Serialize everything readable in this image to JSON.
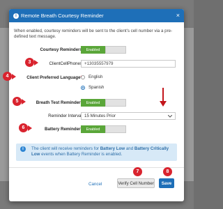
{
  "dialog": {
    "title": "Remote Breath Courtesy Reminder",
    "close_label": "×",
    "intro": "When enabled, courtesy reminders will be sent to the client's cell number via a pre-defined text message."
  },
  "fields": {
    "courtesy_reminders": {
      "label": "Courtesy Reminders",
      "toggle": "Enabled"
    },
    "client_cell_phones": {
      "label": "ClientCellPhones",
      "value": "+13035557979"
    },
    "preferred_language": {
      "label": "Client Preferred Language",
      "options": [
        {
          "label": "English",
          "selected": false
        },
        {
          "label": "Spanish",
          "selected": true
        }
      ]
    },
    "breath_test_reminder": {
      "label": "Breath Test Reminder",
      "toggle": "Enabled"
    },
    "reminder_interval": {
      "label": "Reminder Interval",
      "value": "15 Minutes Prior"
    },
    "battery_reminder": {
      "label": "Battery Reminder",
      "toggle": "Enabled"
    }
  },
  "info": {
    "text_1": "The client will receive reminders for ",
    "bold_1": "Battery Low",
    "text_2": " and ",
    "bold_2": "Battery Critically Low",
    "text_3": " events when Battery Reminder is enabled."
  },
  "footer": {
    "cancel_label": "Cancel",
    "verify_label": "Verify Cell Number",
    "save_label": "Save"
  },
  "callouts": [
    "3",
    "4",
    "5",
    "6",
    "7",
    "8"
  ],
  "required_mark": "*",
  "colors": {
    "header": "#1e6fb8",
    "enabled": "#5aa639",
    "callout": "#d9232e",
    "info_bg": "#d7e9f7"
  }
}
